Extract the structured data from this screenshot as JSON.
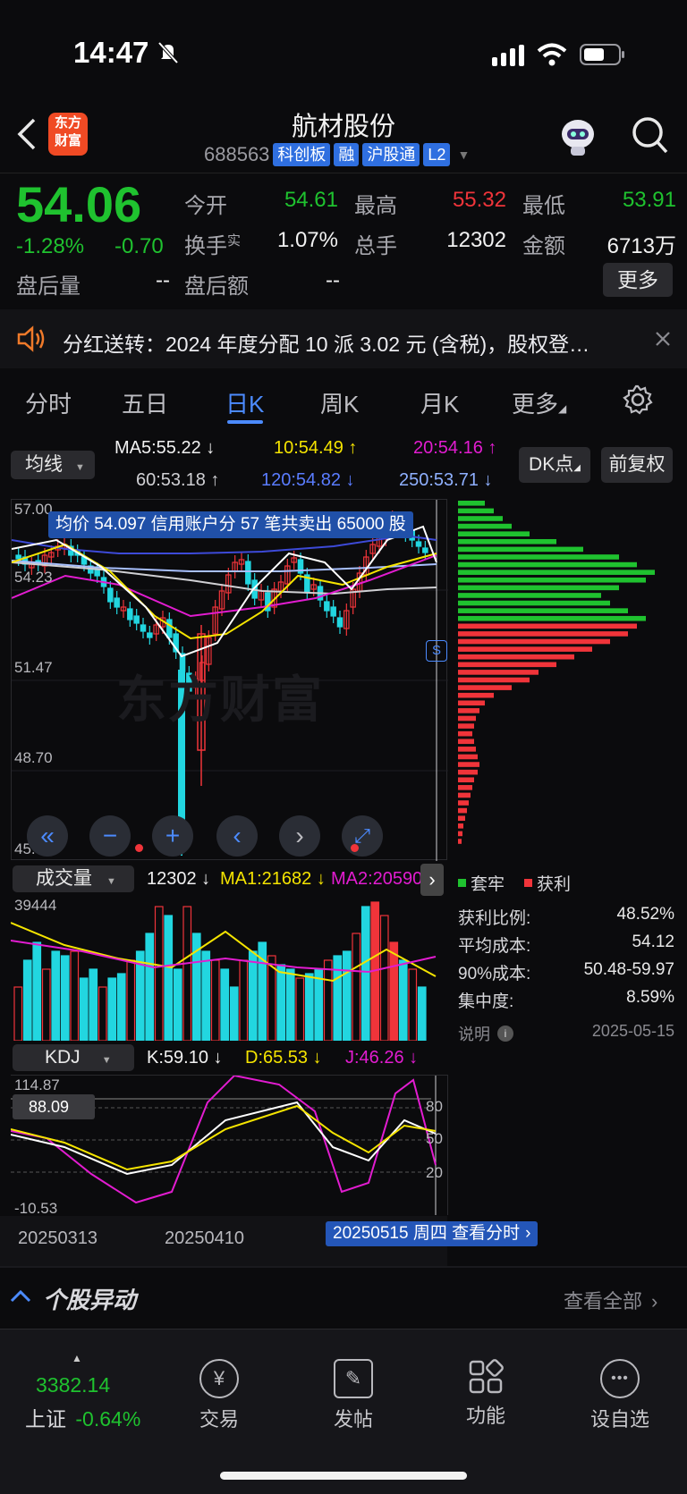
{
  "status_bar": {
    "time": "14:47"
  },
  "header": {
    "logo_line1": "东方",
    "logo_line2": "财富",
    "title": "航材股份",
    "code": "688563",
    "tags": [
      "科创板",
      "融",
      "沪股通",
      "L2"
    ]
  },
  "quote": {
    "price": "54.06",
    "change_pct": "-1.28%",
    "change": "-0.70",
    "open_label": "今开",
    "open": "54.61",
    "high_label": "最高",
    "high": "55.32",
    "low_label": "最低",
    "low": "53.91",
    "turnover_label": "换手",
    "turnover_sup": "实",
    "turnover": "1.07%",
    "volume_label": "总手",
    "volume": "12302",
    "amount_label": "金额",
    "amount": "6713万",
    "after_vol_label": "盘后量",
    "after_vol": "--",
    "after_amt_label": "盘后额",
    "after_amt": "--",
    "more": "更多"
  },
  "notice": {
    "text": "分红送转：2024 年度分配 10 派 3.02 元 (含税)，股权登…"
  },
  "tabs": [
    "分时",
    "五日",
    "日K",
    "周K",
    "月K",
    "更多"
  ],
  "active_tab": "日K",
  "ma_bar": {
    "selector": "均线",
    "ma5": "MA5:55.22 ↓",
    "ma10": "10:54.49 ↑",
    "ma20": "20:54.16 ↑",
    "ma60": "60:53.18 ↑",
    "ma120": "120:54.82 ↓",
    "ma250": "250:53.71 ↓",
    "dk": "DK点",
    "fq": "前复权"
  },
  "chart_banner": "均价 54.097 信用账户分 57 笔共卖出 65000 股",
  "price_axis": [
    "57.00",
    "54.23",
    "51.47",
    "48.70",
    "45.93"
  ],
  "volume_bar": {
    "selector": "成交量",
    "vol": "12302 ↓",
    "ma1": "MA1:21682 ↓",
    "ma2": "MA2:20590",
    "max": "39444"
  },
  "kdj_bar": {
    "selector": "KDJ",
    "k": "K:59.10 ↓",
    "d": "D:65.53 ↓",
    "j": "J:46.26 ↓",
    "top": "114.87",
    "bottom": "-10.53",
    "cursor": "88.09",
    "levels": [
      "80",
      "50",
      "20"
    ]
  },
  "dates": [
    "20250313",
    "20250410"
  ],
  "date_tip": "20250515 周四 查看分时",
  "chip": {
    "legend_trapped": "套牢",
    "legend_profit": "获利",
    "profit_ratio_label": "获利比例:",
    "profit_ratio": "48.52%",
    "avg_cost_label": "平均成本:",
    "avg_cost": "54.12",
    "cost90_label": "90%成本:",
    "cost90": "50.48-59.97",
    "concentration_label": "集中度:",
    "concentration": "8.59%",
    "note_label": "说明",
    "date": "2025-05-15"
  },
  "movers": {
    "title": "个股异动",
    "view_all": "查看全部"
  },
  "bottom_bar": {
    "index_value": "3382.14",
    "index_name": "上证",
    "index_change": "-0.64%",
    "items": [
      "交易",
      "发帖",
      "功能",
      "设自选"
    ]
  },
  "colors": {
    "up": "#f0343a",
    "down": "#1fc22f",
    "candle_down": "#22d6e0",
    "accent": "#2f6fe0"
  }
}
